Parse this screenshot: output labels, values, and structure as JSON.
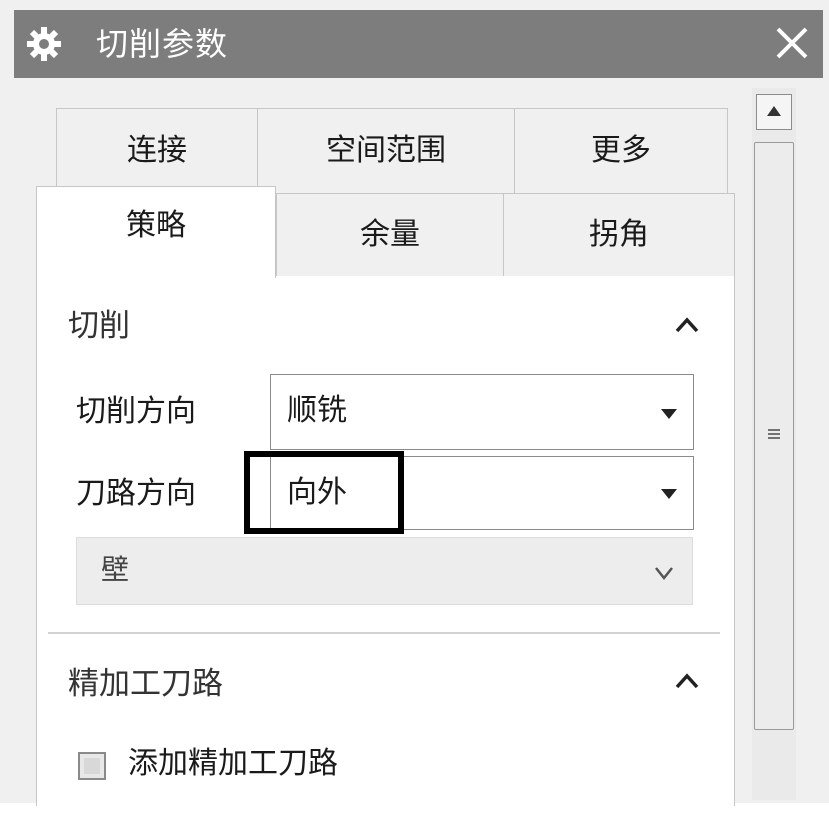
{
  "window": {
    "title": "切削参数",
    "icon": "gear-icon",
    "close_icon": "close-icon"
  },
  "tabs": {
    "row1": [
      {
        "label": "连接"
      },
      {
        "label": "空间范围"
      },
      {
        "label": "更多"
      }
    ],
    "row2": [
      {
        "label": "策略",
        "active": true
      },
      {
        "label": "余量"
      },
      {
        "label": "拐角"
      }
    ]
  },
  "sections": {
    "cut": {
      "title": "切削",
      "expanded": true,
      "fields": [
        {
          "label": "切削方向",
          "value": "顺铣"
        },
        {
          "label": "刀路方向",
          "value": "向外"
        }
      ],
      "subsection": {
        "label": "壁",
        "expanded": false
      }
    },
    "finish": {
      "title": "精加工刀路",
      "expanded": true,
      "checkbox": {
        "label": "添加精加工刀路",
        "checked": false
      }
    }
  },
  "colors": {
    "titlebar": "#7d7d7d",
    "panel": "#ffffff",
    "background": "#f0f0f0",
    "highlight": "#000000"
  }
}
